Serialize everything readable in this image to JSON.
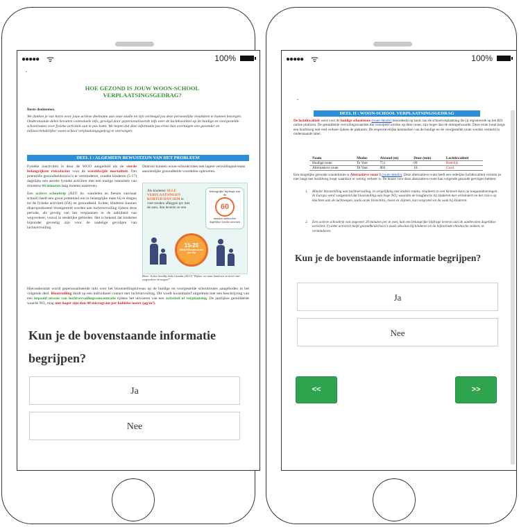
{
  "status_bar": {
    "signal": "●●●●●",
    "wifi": "ᯤ",
    "battery_pct": "100%"
  },
  "left": {
    "bullet": "•",
    "title_line1": "HOE GEZOND IS JOUW WOON-SCHOOL",
    "title_line2": "VERPLAATSINGSGEDRAG?",
    "greeting": "Beste deelnemer,",
    "intro": "We danken je van harte voor jouw actieve deelname aan onze studie en zijn verheugd jou deze persoonlijke resultaten te kunnen bezorgen. Onderstaande delen bevatten contextuele info, gevolgd door gepersonaliseerde info over de luchtkwaliteit op de huidige en voorgestelde schoolroutes voor fysieke activiteit aan te pas komt. We hopen dat deze informatie jou ertoe kan overtuigen een gezonder en milieuvriendelijker woon-school verplaatsingsgedrag te overwegen.",
    "banner": "DEEL I : ALGEMEEN BEWUSTZIJN VAN HET PROBLEEM",
    "col1_p1_a": "Fysieke inactiviteit is door de WGO aangeduid als de ",
    "col1_p1_red1": "vierde belangrijkste risicofactor",
    "col1_p1_b": " voor de ",
    "col1_p1_red2": "wereldwijde mortaliteit",
    "col1_p1_c": ". Om potentiële gezondheidsrisico's te verminderen, zouden kinderen (5-17) dagelijks een aerobe fysieke activiteit met een matige intensiteit van minstens ",
    "col1_p1_grn": "60 minuten",
    "col1_p1_d": " lang moeten nastreven.",
    "col1_p2_a": "Een ",
    "col1_p2_grn": "actieve schooltrip",
    "col1_p2_b": " (AST: bv. wandelen en fietsen van/naar school) heeft een groot potentieel om in belangrijke mate bij te dragen tot de fysieke activiteit (FA) en gezondheid. Echter, kinderen kunnen disproportioneel blootgesteld worden aan luchtvervuiling tijdens deze periode, als gevolg van het verplaatsen in de nabijheid van wegverkeer, vooral in stedelijke gebieden. Het is bekend dat kinderen bijzonder gevoelig zijn voor de nadelige gevolgen van luchtvervuiling.",
    "col2_text": "Daarom kunnen woon-schoolroutes met lagere vervuilingsniveaus aanzienlijke gezondheids-voordelen opleveren.",
    "info_line1": "Als kinderen ",
    "info_line1_hl": "ALLE VERPLAATSINGEN KORTER DAN 1KM",
    "info_line2": "te voet zouden afleggen ipv met de auto, dan leveren ze een",
    "info_bubble": "belangrijke bijdrage aan de",
    "info_bubble_num": "60",
    "info_bubble_sub": "minuten aanbevolen dagelijkse fysieke activiteit",
    "info_clock_num": "15-20",
    "info_clock_label": "MINUTEN wandelen per trip",
    "source": "Bron: Active healthy kids Canada (2013) \"Kijken we naar kinderen actiever met wegverkeer bewegen?\"",
    "bottom_a": "Hieronderstaat wordt gepersonaliseerde info over het blootstellingsniveau op de huidige en voorgestelde schoolroutes aangeboden in het volgende deel. ",
    "bottom_red1": "Blootstelling",
    "bottom_b": " duidt op een individueel contact met luchtvervuiling. Dit wordt kwantitatief uitgedrukt met een beschrijving van een ",
    "bottom_grn1": "bepaald niveau van luchtvervuilingsconcentratie",
    "bottom_c": " tijdens het uitvoeren van een ",
    "bottom_grn2": "activiteit of verplaatsing",
    "bottom_d": ". De jaarlijkse gemiddelde waarde NO₂ mag ",
    "bottom_red2": "niet hoger zijn dan 40 microgram per kubieke meter (μg/m³).",
    "question": "Kun je de bovenstaande informatie begrijpen?",
    "yes": "Ja",
    "no": "Nee"
  },
  "right": {
    "bullet": "•",
    "banner": "DEEL II : WOON-SCHOOL VERPLAATSINGSGEDRAG",
    "p1_red": "De luchtkwaliteit",
    "p1_a": " werd voor de ",
    "p1_red2": "huidige schoolroute",
    "p1_link": "(route details)",
    "p1_b": " beoordeeld op basis van de schoolverplaatsing die jij registreerde op het RIS online platform. De gemiddelde vervuilingswaarden die voorspeld werden op deze route, zijn hoger dan de drempelwaarde. Deze route loopt langs een hoofdweg met veel verkeer tijdens de piekuren. De respectievelijke kenmerken van de huidige en de voorgestelde route worden vermeld in onderstaande tabel.",
    "table_headers": [
      "Naam",
      "Modus",
      "Afstand (m)",
      "Duur (min)",
      "Luchtkwaliteit"
    ],
    "table_rows": [
      [
        "Huidige route",
        "Te Voet",
        "751",
        "09",
        "Redelijk"
      ],
      [
        "Alternatieve route",
        "Te Voet",
        "803",
        "10",
        "Goed"
      ]
    ],
    "p2_a": "Een mogelijke gezonde wandelroute is ",
    "p2_red": "Alternatieve route 1",
    "p2_link": "(route details)",
    "p2_b": ". Deze alternatieve route heeft een redelijke luchtkwaliteit vermits ze niet langs een hoofdweg loopt waardoor er weinig verkeer is. De keuze voor deze alternatieve route kan volgende gezonde gevolgen hebben:",
    "li1": "Minder blootstelling aan luchtvervuiling, in vergelijking met andere routes, resulteert in een kleinere kans op longaandoeningen. In Europa werd vastgesteld dat blootstelling aan hoge NO₂-waarden de longfunctie bij kinderen met vermindert en het risico op klachten aan de luchtwegen, zoals acute bronchitis, hoest en slijmen, kan vergroten en de vaak bij kinderen.",
    "li2": "Een actieve schooltrip van ongeveer 20 minuten per te voet, kan een belangrijke bijdrage leveren aan de aanbevolen dagelijkse activiteit. Fysieke activiteit helpt gezondheidsrisico's zoals obesitas bij kinderen en de bijhorende chronische ziekten, te verminderen.",
    "question": "Kun je de bovenstaande informatie begrijpen?",
    "yes": "Ja",
    "no": "Nee",
    "prev": "<<",
    "next": ">>"
  }
}
